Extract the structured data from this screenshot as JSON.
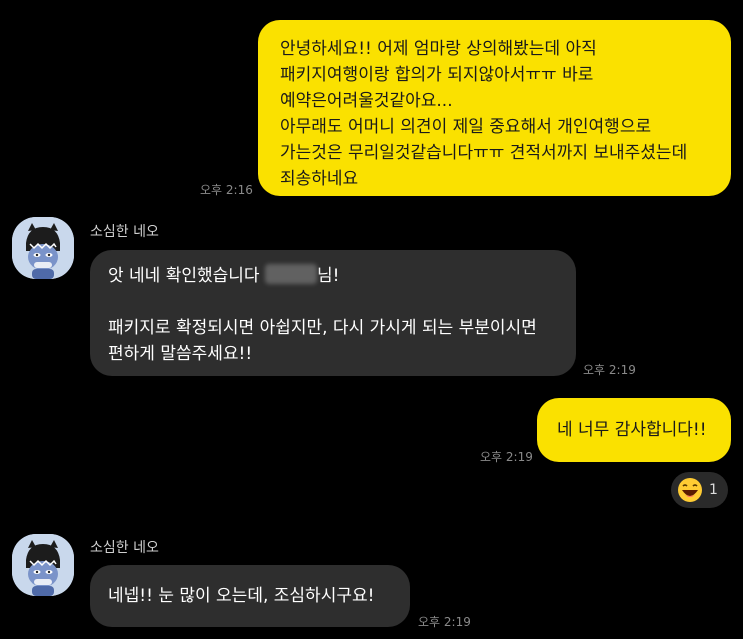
{
  "messages": {
    "m1": {
      "lines": [
        "안녕하세요!! 어제 엄마랑 상의해봤는데 아직",
        "패키지여행이랑 합의가 되지않아서ㅠㅠ 바로",
        "예약은어려울것같아요...",
        "아무래도 어머니 의견이 제일 중요해서 개인여행으로",
        "가는것은 무리일것같습니다ㅠㅠ 견적서까지 보내주셨는데",
        "죄송하네요"
      ],
      "time": "오후 2:16"
    },
    "m2": {
      "sender": "소심한 네오",
      "line1_before": "앗 네네 확인했습니다",
      "line1_after": "님!",
      "line2": "패키지로 확정되시면 아쉽지만, 다시 가시게 되는 부분이시면",
      "line3": "편하게 말씀주세요!!",
      "time": "오후 2:19"
    },
    "m3": {
      "text": "네 너무 감사합니다!!",
      "time": "오후 2:19",
      "reaction_count": "1"
    },
    "m4": {
      "sender": "소심한 네오",
      "text": "네넵!! 눈 많이 오는데, 조심하시구요!",
      "time": "오후 2:19"
    }
  },
  "colors": {
    "outgoing_bubble": "#fae100",
    "incoming_bubble": "#2e2e2e",
    "background": "#000000"
  }
}
